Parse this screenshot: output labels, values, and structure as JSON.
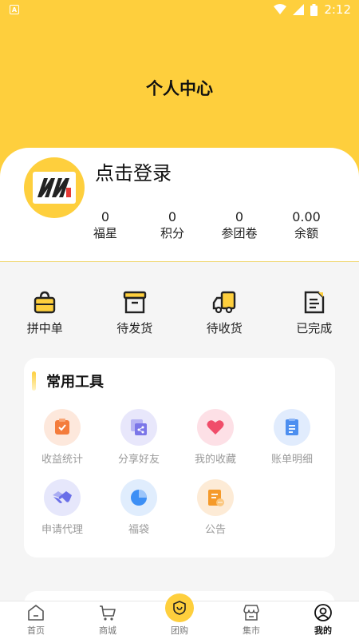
{
  "status_bar": {
    "time": "2:12",
    "app_badge": "A"
  },
  "header": {
    "title": "个人中心"
  },
  "profile": {
    "login_text": "点击登录",
    "stats": [
      {
        "value": "0",
        "label": "福星"
      },
      {
        "value": "0",
        "label": "积分"
      },
      {
        "value": "0",
        "label": "参团卷"
      },
      {
        "value": "0.00",
        "label": "余额"
      }
    ]
  },
  "orders": [
    {
      "label": "拼中单",
      "icon": "shopping-bag-icon"
    },
    {
      "label": "待发货",
      "icon": "box-icon"
    },
    {
      "label": "待收货",
      "icon": "truck-icon"
    },
    {
      "label": "已完成",
      "icon": "completed-document-icon"
    }
  ],
  "tools": {
    "title": "常用工具",
    "items": [
      {
        "label": "收益统计",
        "icon": "earnings-icon",
        "color": "#f47c3c",
        "bg": "#fde8dc"
      },
      {
        "label": "分享好友",
        "icon": "share-icon",
        "color": "#7b76e8",
        "bg": "#e8e7fb"
      },
      {
        "label": "我的收藏",
        "icon": "heart-icon",
        "color": "#f04d6a",
        "bg": "#fde0e6"
      },
      {
        "label": "账单明细",
        "icon": "bill-icon",
        "color": "#4d8ff0",
        "bg": "#e1ecfd"
      },
      {
        "label": "申请代理",
        "icon": "handshake-icon",
        "color": "#6a6fe8",
        "bg": "#e6e7fb"
      },
      {
        "label": "福袋",
        "icon": "pie-icon",
        "color": "#3d8ff5",
        "bg": "#e0edfd"
      },
      {
        "label": "公告",
        "icon": "notice-icon",
        "color": "#f59a2a",
        "bg": "#fdebd6"
      }
    ]
  },
  "tabbar": [
    {
      "label": "首页",
      "icon": "home-icon"
    },
    {
      "label": "商城",
      "icon": "cart-icon"
    },
    {
      "label": "团购",
      "icon": "group-buy-icon"
    },
    {
      "label": "集市",
      "icon": "market-icon"
    },
    {
      "label": "我的",
      "icon": "user-icon"
    }
  ],
  "colors": {
    "brand": "#fecf3d",
    "background": "#f5f5f5"
  }
}
